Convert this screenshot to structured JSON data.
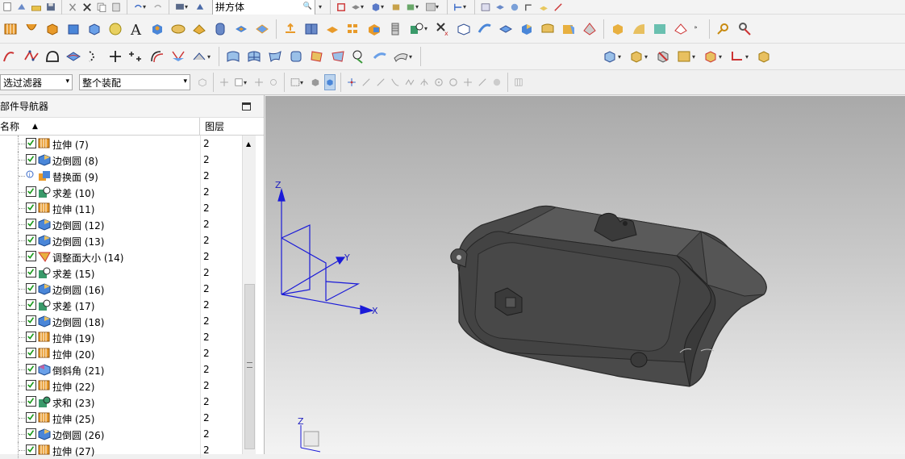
{
  "toolbar": {
    "body_type_combo": "拼方体",
    "filter_combo": "选过滤器",
    "assembly_combo": "整个装配"
  },
  "navigator": {
    "title": "部件导航器",
    "col_name": "名称",
    "col_layer": "图层",
    "items": [
      {
        "label": "拉伸 (7)",
        "layer": "2",
        "icon": "extrude-icon"
      },
      {
        "label": "边倒圆 (8)",
        "layer": "2",
        "icon": "edge-blend-icon"
      },
      {
        "label": "替换面 (9)",
        "layer": "2",
        "icon": "replace-face-icon"
      },
      {
        "label": "求差 (10)",
        "layer": "2",
        "icon": "subtract-icon"
      },
      {
        "label": "拉伸 (11)",
        "layer": "2",
        "icon": "extrude-icon"
      },
      {
        "label": "边倒圆 (12)",
        "layer": "2",
        "icon": "edge-blend-icon"
      },
      {
        "label": "边倒圆 (13)",
        "layer": "2",
        "icon": "edge-blend-icon"
      },
      {
        "label": "调整面大小 (14)",
        "layer": "2",
        "icon": "resize-face-icon"
      },
      {
        "label": "求差 (15)",
        "layer": "2",
        "icon": "subtract-icon"
      },
      {
        "label": "边倒圆 (16)",
        "layer": "2",
        "icon": "edge-blend-icon"
      },
      {
        "label": "求差 (17)",
        "layer": "2",
        "icon": "subtract-icon"
      },
      {
        "label": "边倒圆 (18)",
        "layer": "2",
        "icon": "edge-blend-icon"
      },
      {
        "label": "拉伸 (19)",
        "layer": "2",
        "icon": "extrude-icon"
      },
      {
        "label": "拉伸 (20)",
        "layer": "2",
        "icon": "extrude-icon"
      },
      {
        "label": "倒斜角 (21)",
        "layer": "2",
        "icon": "chamfer-icon"
      },
      {
        "label": "拉伸 (22)",
        "layer": "2",
        "icon": "extrude-icon"
      },
      {
        "label": "求和 (23)",
        "layer": "2",
        "icon": "unite-icon"
      },
      {
        "label": "拉伸 (25)",
        "layer": "2",
        "icon": "extrude-icon"
      },
      {
        "label": "边倒圆 (26)",
        "layer": "2",
        "icon": "edge-blend-icon"
      },
      {
        "label": "拉伸 (27)",
        "layer": "2",
        "icon": "extrude-icon"
      }
    ]
  },
  "viewport": {
    "axis_z": "Z",
    "axis_y": "Y",
    "axis_x": "X",
    "mini_z": "Z"
  },
  "colors": {
    "axis_blue": "#1a1ad8",
    "model_gray": "#4a4a4a",
    "check_green": "#1a9a1a"
  }
}
